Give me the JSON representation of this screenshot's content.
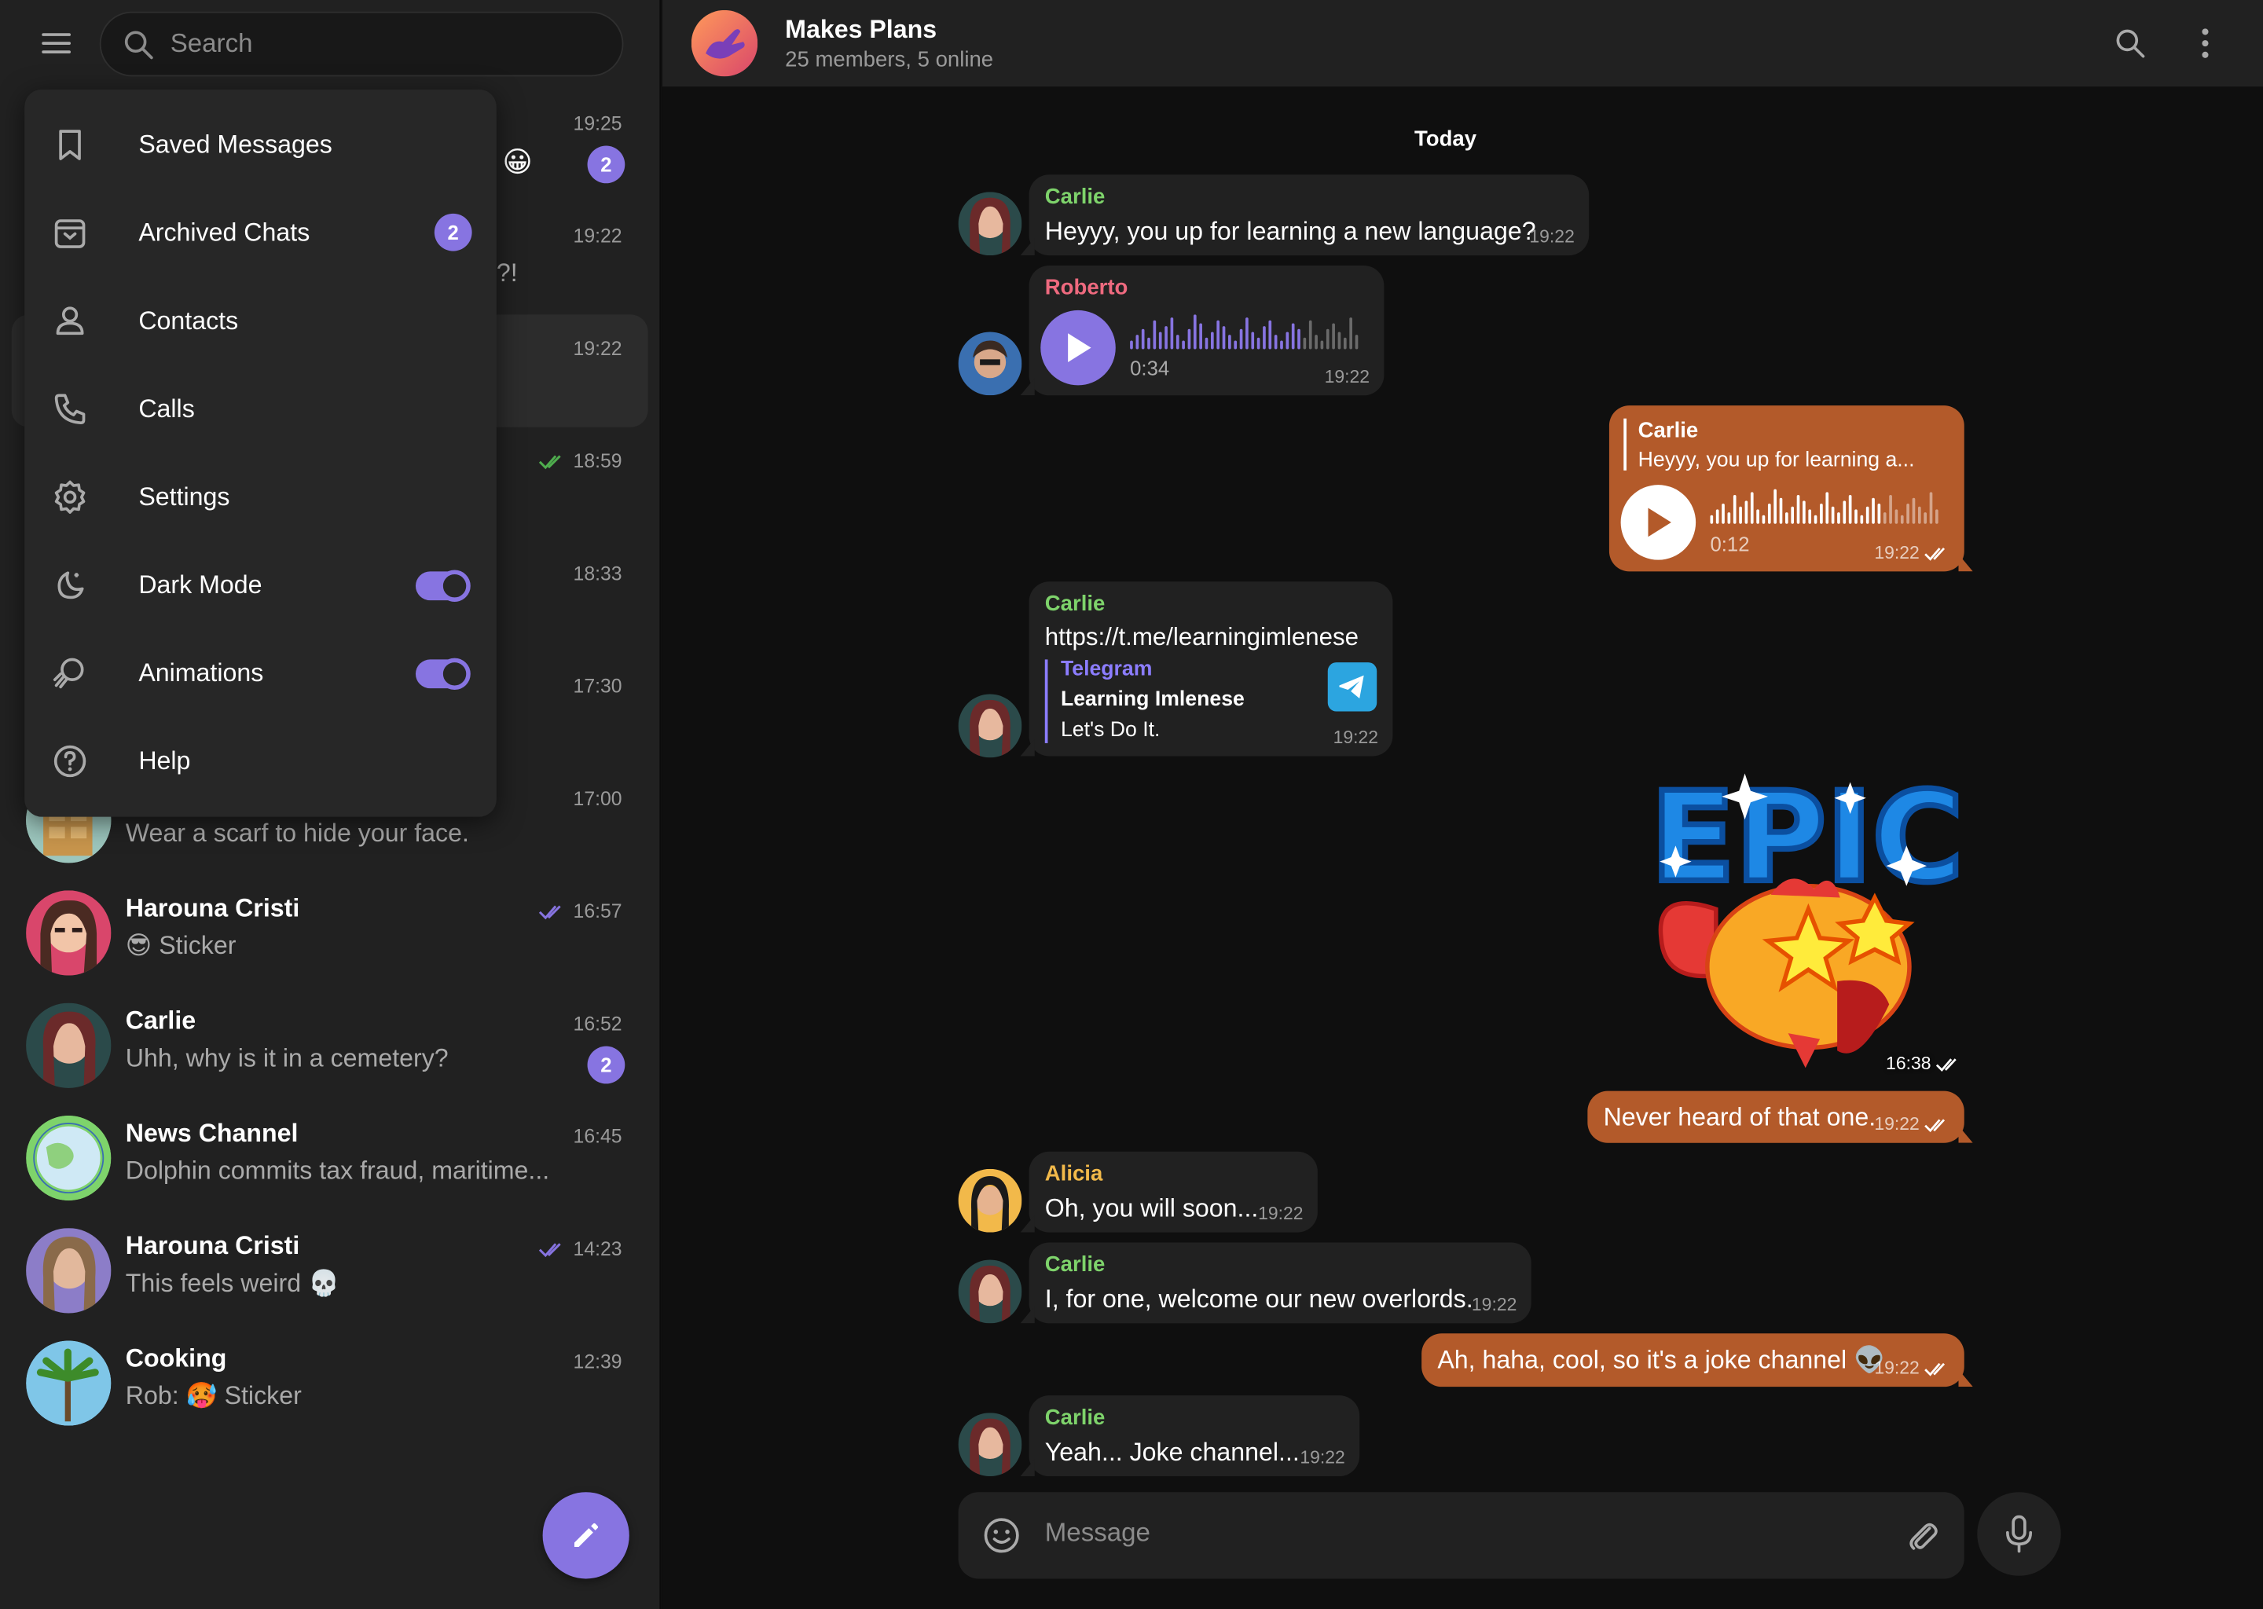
{
  "search": {
    "placeholder": "Search"
  },
  "menu": {
    "items": [
      {
        "label": "Saved Messages"
      },
      {
        "label": "Archived Chats",
        "badge": "2"
      },
      {
        "label": "Contacts"
      },
      {
        "label": "Calls"
      },
      {
        "label": "Settings"
      },
      {
        "label": "Dark Mode",
        "toggle": true
      },
      {
        "label": "Animations",
        "toggle": true
      },
      {
        "label": "Help"
      }
    ]
  },
  "chats": [
    {
      "time": "19:25",
      "badge": "2",
      "emoji": "😀"
    },
    {
      "time": "19:22",
      "preview_tail": "?!"
    },
    {
      "time": "19:22"
    },
    {
      "time": "18:59"
    },
    {
      "time": "18:33"
    },
    {
      "time": "17:30"
    },
    {
      "time": "17:00",
      "preview": "Wear a scarf to hide your face."
    },
    {
      "name": "Harouna Cristi",
      "preview": "😎 Sticker",
      "time": "16:57"
    },
    {
      "name": "Carlie",
      "preview": "Uhh, why is it in a cemetery?",
      "time": "16:52",
      "badge": "2"
    },
    {
      "name": "News Channel",
      "preview": "Dolphin commits tax fraud, maritime...",
      "time": "16:45"
    },
    {
      "name": "Harouna Cristi",
      "preview": "This feels weird 💀",
      "time": "14:23"
    },
    {
      "name": "Cooking",
      "preview": "Rob: 🥵 Sticker",
      "time": "12:39"
    }
  ],
  "header": {
    "title": "Makes Plans",
    "subtitle": "25 members, 5 online"
  },
  "date_divider": "Today",
  "messages": {
    "m1": {
      "sender": "Carlie",
      "text": "Heyyy, you up for learning a new language?",
      "time": "19:22"
    },
    "m2": {
      "sender": "Roberto",
      "duration": "0:34",
      "time": "19:22"
    },
    "m3": {
      "reply_sender": "Carlie",
      "reply_text": "Heyyy, you up for learning a...",
      "duration": "0:12",
      "time": "19:22"
    },
    "m4": {
      "sender": "Carlie",
      "link": "https://t.me/learningimlenese",
      "preview_site": "Telegram",
      "preview_title": "Learning Imlenese",
      "preview_desc": "Let's Do It.",
      "time": "19:22"
    },
    "m5": {
      "sticker_text": "EPIC",
      "time": "16:38"
    },
    "m6": {
      "text": "Never heard of that one.",
      "time": "19:22"
    },
    "m7": {
      "sender": "Alicia",
      "text": "Oh, you will soon...",
      "time": "19:22"
    },
    "m8": {
      "sender": "Carlie",
      "text": "I, for one, welcome our new overlords.",
      "time": "19:22"
    },
    "m9": {
      "text": "Ah, haha, cool, so it's a joke channel 👽",
      "time": "19:22"
    },
    "m10": {
      "sender": "Carlie",
      "text": "Yeah... Joke channel...",
      "time": "19:22"
    }
  },
  "composer": {
    "placeholder": "Message"
  },
  "colors": {
    "accent": "#8774e1",
    "outgoing": "#b35a2a",
    "carlie": "#7ed36b",
    "roberto": "#ef6a7f",
    "alicia": "#f2b94a"
  }
}
